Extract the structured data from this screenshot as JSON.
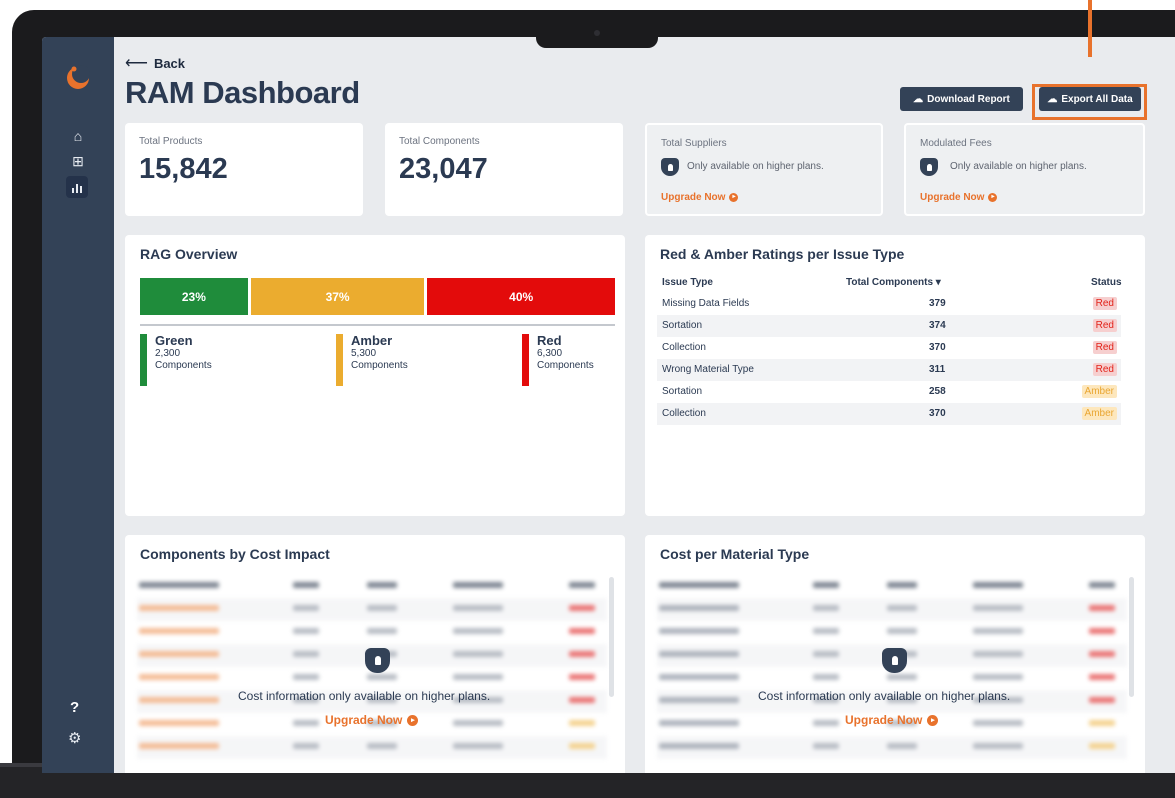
{
  "nav": {
    "back_label": "Back",
    "help": "?"
  },
  "page": {
    "title": "RAM Dashboard"
  },
  "actions": {
    "download_label": "Download Report",
    "export_label": "Export All Data"
  },
  "stats": {
    "total_products": {
      "label": "Total Products",
      "value": "15,842"
    },
    "total_components": {
      "label": "Total Components",
      "value": "23,047"
    },
    "total_suppliers": {
      "label": "Total Suppliers",
      "locked_text": "Only available on higher plans.",
      "upgrade_label": "Upgrade Now"
    },
    "modulated_fees": {
      "label": "Modulated Fees",
      "locked_text": "Only available on higher plans.",
      "upgrade_label": "Upgrade Now"
    }
  },
  "rag": {
    "title": "RAG Overview",
    "segments": [
      {
        "label": "23%",
        "percent": 23,
        "color": "#1f8c3b"
      },
      {
        "label": "37%",
        "percent": 37,
        "color": "#ebac2f"
      },
      {
        "label": "40%",
        "percent": 40,
        "color": "#e30b0b"
      }
    ],
    "legend": [
      {
        "name": "Green",
        "count": "2,300",
        "unit": "Components",
        "color": "#1f8c3b"
      },
      {
        "name": "Amber",
        "count": "5,300",
        "unit": "Components",
        "color": "#ebac2f"
      },
      {
        "name": "Red",
        "count": "6,300",
        "unit": "Components",
        "color": "#e30b0b"
      }
    ]
  },
  "ratings": {
    "title": "Red & Amber Ratings per Issue Type",
    "headers": {
      "issue": "Issue Type",
      "total": "Total Components ▾",
      "status": "Status"
    },
    "rows": [
      {
        "issue": "Missing Data Fields",
        "total": "379",
        "status": "Red"
      },
      {
        "issue": "Sortation",
        "total": "374",
        "status": "Red"
      },
      {
        "issue": "Collection",
        "total": "370",
        "status": "Red"
      },
      {
        "issue": "Wrong Material Type",
        "total": "311",
        "status": "Red"
      },
      {
        "issue": "Sortation",
        "total": "258",
        "status": "Amber"
      },
      {
        "issue": "Collection",
        "total": "370",
        "status": "Amber"
      }
    ]
  },
  "cost_impact": {
    "title": "Components by Cost Impact",
    "locked_text": "Cost information only available on higher plans.",
    "upgrade_label": "Upgrade Now"
  },
  "material_cost": {
    "title": "Cost per Material Type",
    "locked_text": "Cost information only available on higher plans.",
    "upgrade_label": "Upgrade Now"
  },
  "colors": {
    "accent": "#e8722c",
    "sidebar": "#334257",
    "title": "#2b3a52"
  }
}
